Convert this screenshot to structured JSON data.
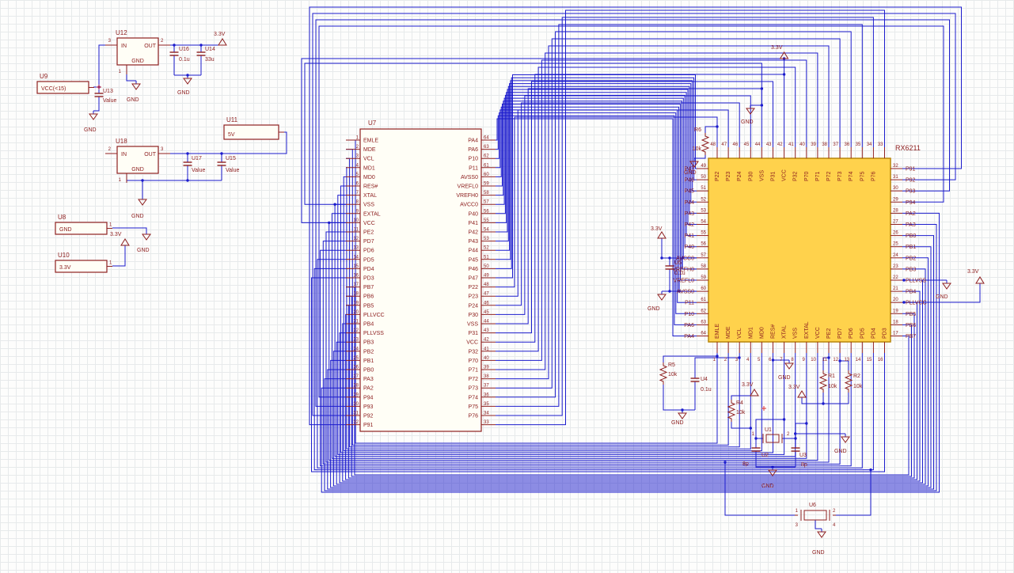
{
  "power": {
    "v33": "3.3V",
    "v5": "5V",
    "gnd": "GND"
  },
  "colors": {
    "wire": "#1b1bcd",
    "symbol": "#8e2020",
    "qfp_fill": "#ffd24c",
    "qfp_border": "#b8860b",
    "junction": "#1b1bcd",
    "origin_cross": "#d83030"
  },
  "u7": {
    "ref": "U7",
    "left_pins": [
      {
        "num": "1",
        "name": "EMLE"
      },
      {
        "num": "2",
        "name": "MDE"
      },
      {
        "num": "3",
        "name": "VCL"
      },
      {
        "num": "4",
        "name": "MD1"
      },
      {
        "num": "5",
        "name": "MD0"
      },
      {
        "num": "6",
        "name": "RES#"
      },
      {
        "num": "7",
        "name": "XTAL"
      },
      {
        "num": "8",
        "name": "VSS"
      },
      {
        "num": "9",
        "name": "EXTAL"
      },
      {
        "num": "10",
        "name": "VCC"
      },
      {
        "num": "11",
        "name": "PE2"
      },
      {
        "num": "12",
        "name": "PD7"
      },
      {
        "num": "13",
        "name": "PD6"
      },
      {
        "num": "14",
        "name": "PD5"
      },
      {
        "num": "15",
        "name": "PD4"
      },
      {
        "num": "16",
        "name": "PD3"
      },
      {
        "num": "17",
        "name": "PB7"
      },
      {
        "num": "18",
        "name": "PB6"
      },
      {
        "num": "19",
        "name": "PB5"
      },
      {
        "num": "20",
        "name": "PLLVCC"
      },
      {
        "num": "21",
        "name": "PB4"
      },
      {
        "num": "22",
        "name": "PLLVSS"
      },
      {
        "num": "23",
        "name": "PB3"
      },
      {
        "num": "24",
        "name": "PB2"
      },
      {
        "num": "25",
        "name": "PB1"
      },
      {
        "num": "26",
        "name": "PB0"
      },
      {
        "num": "27",
        "name": "PA3"
      },
      {
        "num": "28",
        "name": "PA2"
      },
      {
        "num": "29",
        "name": "P94"
      },
      {
        "num": "30",
        "name": "P93"
      },
      {
        "num": "31",
        "name": "P92"
      },
      {
        "num": "32",
        "name": "P91"
      }
    ],
    "right_pins": [
      {
        "num": "64",
        "name": "PA4"
      },
      {
        "num": "63",
        "name": "PA6"
      },
      {
        "num": "62",
        "name": "P10"
      },
      {
        "num": "61",
        "name": "P11"
      },
      {
        "num": "60",
        "name": "AVSS0"
      },
      {
        "num": "59",
        "name": "VREFL0"
      },
      {
        "num": "58",
        "name": "VREFH0"
      },
      {
        "num": "57",
        "name": "AVCC0"
      },
      {
        "num": "56",
        "name": "P40"
      },
      {
        "num": "55",
        "name": "P41"
      },
      {
        "num": "54",
        "name": "P42"
      },
      {
        "num": "53",
        "name": "P43"
      },
      {
        "num": "52",
        "name": "P44"
      },
      {
        "num": "51",
        "name": "P45"
      },
      {
        "num": "50",
        "name": "P46"
      },
      {
        "num": "49",
        "name": "P47"
      },
      {
        "num": "48",
        "name": "P22"
      },
      {
        "num": "47",
        "name": "P23"
      },
      {
        "num": "46",
        "name": "P24"
      },
      {
        "num": "45",
        "name": "P30"
      },
      {
        "num": "44",
        "name": "VSS"
      },
      {
        "num": "43",
        "name": "P31"
      },
      {
        "num": "42",
        "name": "VCC"
      },
      {
        "num": "41",
        "name": "P32"
      },
      {
        "num": "40",
        "name": "P70"
      },
      {
        "num": "39",
        "name": "P71"
      },
      {
        "num": "38",
        "name": "P72"
      },
      {
        "num": "37",
        "name": "P73"
      },
      {
        "num": "36",
        "name": "P74"
      },
      {
        "num": "35",
        "name": "P75"
      },
      {
        "num": "34",
        "name": "P76"
      },
      {
        "num": "33",
        "name": ""
      }
    ]
  },
  "qfp": {
    "ref": "RX6211",
    "top_pins": [
      {
        "num": "48",
        "name": "P22"
      },
      {
        "num": "47",
        "name": "P23"
      },
      {
        "num": "46",
        "name": "P24"
      },
      {
        "num": "45",
        "name": "P30"
      },
      {
        "num": "44",
        "name": "VSS"
      },
      {
        "num": "43",
        "name": "P31"
      },
      {
        "num": "42",
        "name": "VCC"
      },
      {
        "num": "41",
        "name": "P32"
      },
      {
        "num": "40",
        "name": "P70"
      },
      {
        "num": "39",
        "name": "P71"
      },
      {
        "num": "38",
        "name": "P72"
      },
      {
        "num": "37",
        "name": "P73"
      },
      {
        "num": "36",
        "name": "P74"
      },
      {
        "num": "35",
        "name": "P75"
      },
      {
        "num": "34",
        "name": "P76"
      },
      {
        "num": "33",
        "name": ""
      }
    ],
    "left_pins": [
      {
        "num": "49",
        "name": "P47"
      },
      {
        "num": "50",
        "name": "P46"
      },
      {
        "num": "51",
        "name": "P45"
      },
      {
        "num": "52",
        "name": "P44"
      },
      {
        "num": "53",
        "name": "P43"
      },
      {
        "num": "54",
        "name": "P42"
      },
      {
        "num": "55",
        "name": "P41"
      },
      {
        "num": "56",
        "name": "P40"
      },
      {
        "num": "57",
        "name": "AVCC0"
      },
      {
        "num": "58",
        "name": "VREFH0"
      },
      {
        "num": "59",
        "name": "VREFL0"
      },
      {
        "num": "60",
        "name": "AVSS0"
      },
      {
        "num": "61",
        "name": "P11"
      },
      {
        "num": "62",
        "name": "P10"
      },
      {
        "num": "63",
        "name": "PA6"
      },
      {
        "num": "64",
        "name": "PA4"
      }
    ],
    "right_pins": [
      {
        "num": "32",
        "name": "P91"
      },
      {
        "num": "31",
        "name": "P92"
      },
      {
        "num": "30",
        "name": "P93"
      },
      {
        "num": "29",
        "name": "P94"
      },
      {
        "num": "28",
        "name": "PA2"
      },
      {
        "num": "27",
        "name": "PA3"
      },
      {
        "num": "26",
        "name": "PB0"
      },
      {
        "num": "25",
        "name": "PB1"
      },
      {
        "num": "24",
        "name": "PB2"
      },
      {
        "num": "23",
        "name": "PB3"
      },
      {
        "num": "22",
        "name": "PLLVSS"
      },
      {
        "num": "21",
        "name": "PB4"
      },
      {
        "num": "20",
        "name": "PLLVCC"
      },
      {
        "num": "19",
        "name": "PB5"
      },
      {
        "num": "18",
        "name": "PB6"
      },
      {
        "num": "17",
        "name": "PB7"
      }
    ],
    "bottom_pins": [
      {
        "num": "1",
        "name": "EMLE"
      },
      {
        "num": "2",
        "name": "MDE"
      },
      {
        "num": "3",
        "name": "VCL"
      },
      {
        "num": "4",
        "name": "MD1"
      },
      {
        "num": "5",
        "name": "MD0"
      },
      {
        "num": "6",
        "name": "RES#"
      },
      {
        "num": "7",
        "name": "XTAL"
      },
      {
        "num": "8",
        "name": "VSS"
      },
      {
        "num": "9",
        "name": "EXTAL"
      },
      {
        "num": "10",
        "name": "VCC"
      },
      {
        "num": "11",
        "name": "PE2"
      },
      {
        "num": "12",
        "name": "PD7"
      },
      {
        "num": "13",
        "name": "PD6"
      },
      {
        "num": "14",
        "name": "PD5"
      },
      {
        "num": "15",
        "name": "PD4"
      },
      {
        "num": "16",
        "name": "PD3"
      }
    ]
  },
  "parts": {
    "u12": {
      "ref": "U12",
      "in": "IN",
      "out": "OUT",
      "gnd": "GND",
      "pin_left": "3",
      "pin_right": "2",
      "pin_bottom": "1"
    },
    "u16": {
      "ref": "U16",
      "value": "0.1u"
    },
    "u14": {
      "ref": "U14",
      "value": "33u"
    },
    "u9": {
      "ref": "U9",
      "value": "VCC(<15)"
    },
    "u13": {
      "ref": "U13",
      "value": "Value"
    },
    "u18": {
      "ref": "U18",
      "in": "IN",
      "out": "OUT",
      "gnd": "GND",
      "pin_left": "2",
      "pin_right": "3",
      "pin_bottom": "1"
    },
    "u17": {
      "ref": "U17",
      "value": "Value"
    },
    "u15": {
      "ref": "U15",
      "value": "Value"
    },
    "u11": {
      "ref": "U11",
      "value": "5V"
    },
    "u8": {
      "ref": "U8",
      "value": "GND",
      "pin": "1"
    },
    "u10": {
      "ref": "U10",
      "value": "3.3V",
      "pin": "1"
    },
    "r6": {
      "ref": "R6",
      "value": "10k"
    },
    "r5": {
      "ref": "R5",
      "value": "10k"
    },
    "r4": {
      "ref": "R4",
      "value": "10k"
    },
    "r1": {
      "ref": "R1",
      "value": "10k"
    },
    "r2": {
      "ref": "R2",
      "value": "10k"
    },
    "u4": {
      "ref": "U4",
      "value": "0.1u"
    },
    "u5": {
      "ref": "U5",
      "value": "0.1u"
    },
    "u1": {
      "ref": "U1",
      "pin1": "1",
      "pin2": "2"
    },
    "u2": {
      "ref": "U2",
      "value": "8p"
    },
    "u3": {
      "ref": "U3",
      "value": "8p"
    },
    "u6": {
      "ref": "U6",
      "pin1": "1",
      "pin2": "2",
      "pin3": "3",
      "pin4": "4"
    }
  }
}
